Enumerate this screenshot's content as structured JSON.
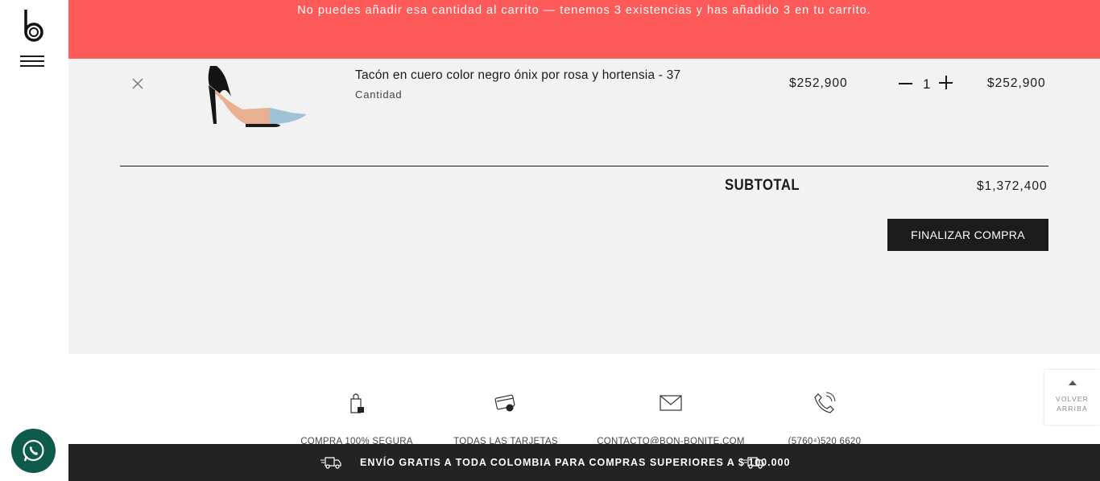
{
  "notice": {
    "text": "No puedes añadir esa cantidad al carrito — tenemos 3 existencias y has añadido 3 en tu carrito."
  },
  "cart": {
    "item": {
      "name": "Tacón en cuero color negro ónix por rosa y hortensia - 37",
      "qty_label": "Cantidad",
      "unit_price": "$252,900",
      "quantity": "1",
      "line_total": "$252,900"
    },
    "subtotal_label": "SUBTOTAL",
    "subtotal_value": "$1,372,400",
    "checkout_label": "FINALIZAR COMPRA"
  },
  "features": [
    {
      "label": "COMPRA 100% SEGURA",
      "icon": "secure-bag-icon"
    },
    {
      "label": "TODAS LAS TARJETAS",
      "icon": "cards-icon"
    },
    {
      "label": "CONTACTO@BON-BONITE.COM",
      "icon": "mail-icon"
    },
    {
      "label": "(5760⁴)520 6620",
      "icon": "phone-icon"
    }
  ],
  "back_to_top": {
    "line1": "VOLVER",
    "line2": "ARRIBA"
  },
  "shipping_bar": {
    "text": "ENVÍO GRATIS A TODA COLOMBIA PARA COMPRAS SUPERIORES A $ 100.000"
  },
  "colors": {
    "notice_bg": "#ff5a5a",
    "cart_bg": "#f2f2f2",
    "dark": "#232323",
    "whatsapp": "#0f5b4b"
  }
}
